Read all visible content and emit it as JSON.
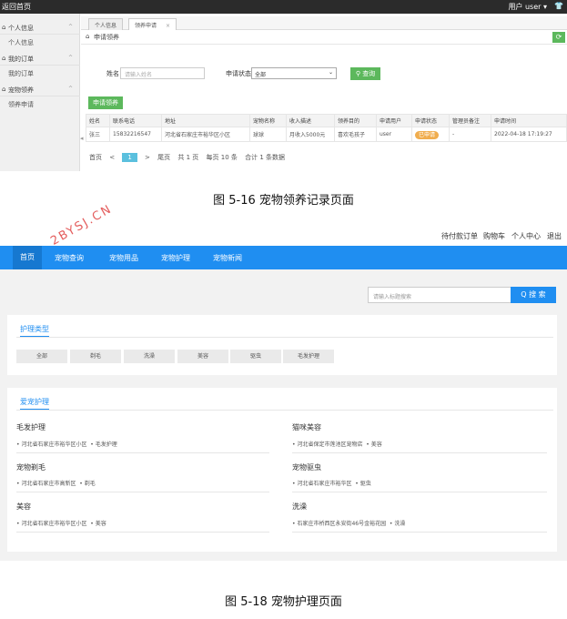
{
  "admin": {
    "topbar": {
      "back_label": "返回首页",
      "user_label": "用户 user ▾",
      "shirt_icon": "👕"
    },
    "sidebar": [
      {
        "group": "个人信息",
        "items": [
          "个人信息"
        ]
      },
      {
        "group": "我的订单",
        "items": [
          "我的订单"
        ]
      },
      {
        "group": "宠物领养",
        "items": [
          "领养申请"
        ]
      }
    ],
    "tabs": [
      "个人信息",
      "领养申请"
    ],
    "crumb": "申请领养",
    "filters": {
      "name_label": "姓名",
      "name_placeholder": "请输入姓名",
      "status_label": "申请状态",
      "status_value": "全部",
      "search_label": "查询"
    },
    "apply_button": "申请领养",
    "table": {
      "headers": [
        "姓名",
        "联系电话",
        "地址",
        "宠物名称",
        "收入描述",
        "领养目的",
        "申请用户",
        "申请状态",
        "管理员备注",
        "申请时间"
      ],
      "rows": [
        [
          "张三",
          "15832216547",
          "河北省石家庄市裕华区小区",
          "球球",
          "月收入5000元",
          "喜欢毛孩子",
          "user",
          "已申请",
          "-",
          "2022-04-18 17:19:27"
        ]
      ]
    },
    "pager": {
      "first": "首页",
      "prev": "<",
      "current": "1",
      "next": ">",
      "last": "尾页",
      "total_pages": "共 1 页",
      "per_page": "每页 10 条",
      "total": "合计 1 条数据"
    }
  },
  "caption1": "图 5-16 宠物领养记录页面",
  "watermark": "2BYSJ.CN",
  "front": {
    "top_links": [
      "待付款订单",
      "购物车",
      "个人中心",
      "退出"
    ],
    "nav": [
      "首页",
      "宠物查询",
      "宠物用品",
      "宠物护理",
      "宠物新闻"
    ],
    "search": {
      "placeholder": "请输入标题搜索",
      "button": "Q 搜 索"
    },
    "types_title": "护理类型",
    "types": [
      "全部",
      "剃毛",
      "洗澡",
      "美容",
      "驱虫",
      "毛发护理"
    ],
    "care_title": "爱宠护理",
    "services": [
      {
        "title": "毛发护理",
        "address": "河北省石家庄市裕华区小区",
        "type": "毛发护理"
      },
      {
        "title": "猫咪美容",
        "address": "河北省保定市莲池区宠物店",
        "type": "美容"
      },
      {
        "title": "宠物剃毛",
        "address": "河北省石家庄市高新区",
        "type": "剃毛"
      },
      {
        "title": "宠物驱虫",
        "address": "河北省石家庄市裕华区",
        "type": "驱虫"
      },
      {
        "title": "美容",
        "address": "河北省石家庄市裕华区小区",
        "type": "美容"
      },
      {
        "title": "洗澡",
        "address": "石家庄市桥西区永安街46号金裕花园",
        "type": "洗澡"
      }
    ]
  },
  "caption2": "图 5-18 宠物护理页面"
}
